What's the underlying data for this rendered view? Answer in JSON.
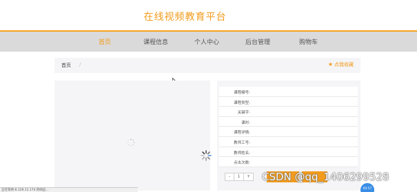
{
  "site": {
    "title": "在线视频教育平台"
  },
  "nav": {
    "items": [
      {
        "label": "首页",
        "active": true
      },
      {
        "label": "课程信息",
        "active": false
      },
      {
        "label": "个人中心",
        "active": false
      },
      {
        "label": "后台管理",
        "active": false
      },
      {
        "label": "购物车",
        "active": false
      }
    ]
  },
  "breadcrumb": {
    "home": "首页",
    "separator": "/"
  },
  "favorite": {
    "icon": "star-icon",
    "label": "点我收藏"
  },
  "course_info": {
    "fields": [
      {
        "label": "课程编号:"
      },
      {
        "label": "课程类型:"
      },
      {
        "label": "关键字:"
      },
      {
        "label": "课时:"
      },
      {
        "label": "课程详情:"
      },
      {
        "label": "教师工号:"
      },
      {
        "label": "教师姓名:"
      },
      {
        "label": "点击次数:"
      }
    ],
    "quantity": {
      "minus": "-",
      "value": "1",
      "plus": "+"
    }
  },
  "watermark": "CSDN @qq_1406299528",
  "status_bar": {
    "text": "正在等待 8.129.11.174 的响应..."
  },
  "badge": {
    "text": "00:57"
  },
  "colors": {
    "accent": "#f29b1c",
    "nav_bg": "#dadada",
    "badge": "#3a8ee6"
  }
}
